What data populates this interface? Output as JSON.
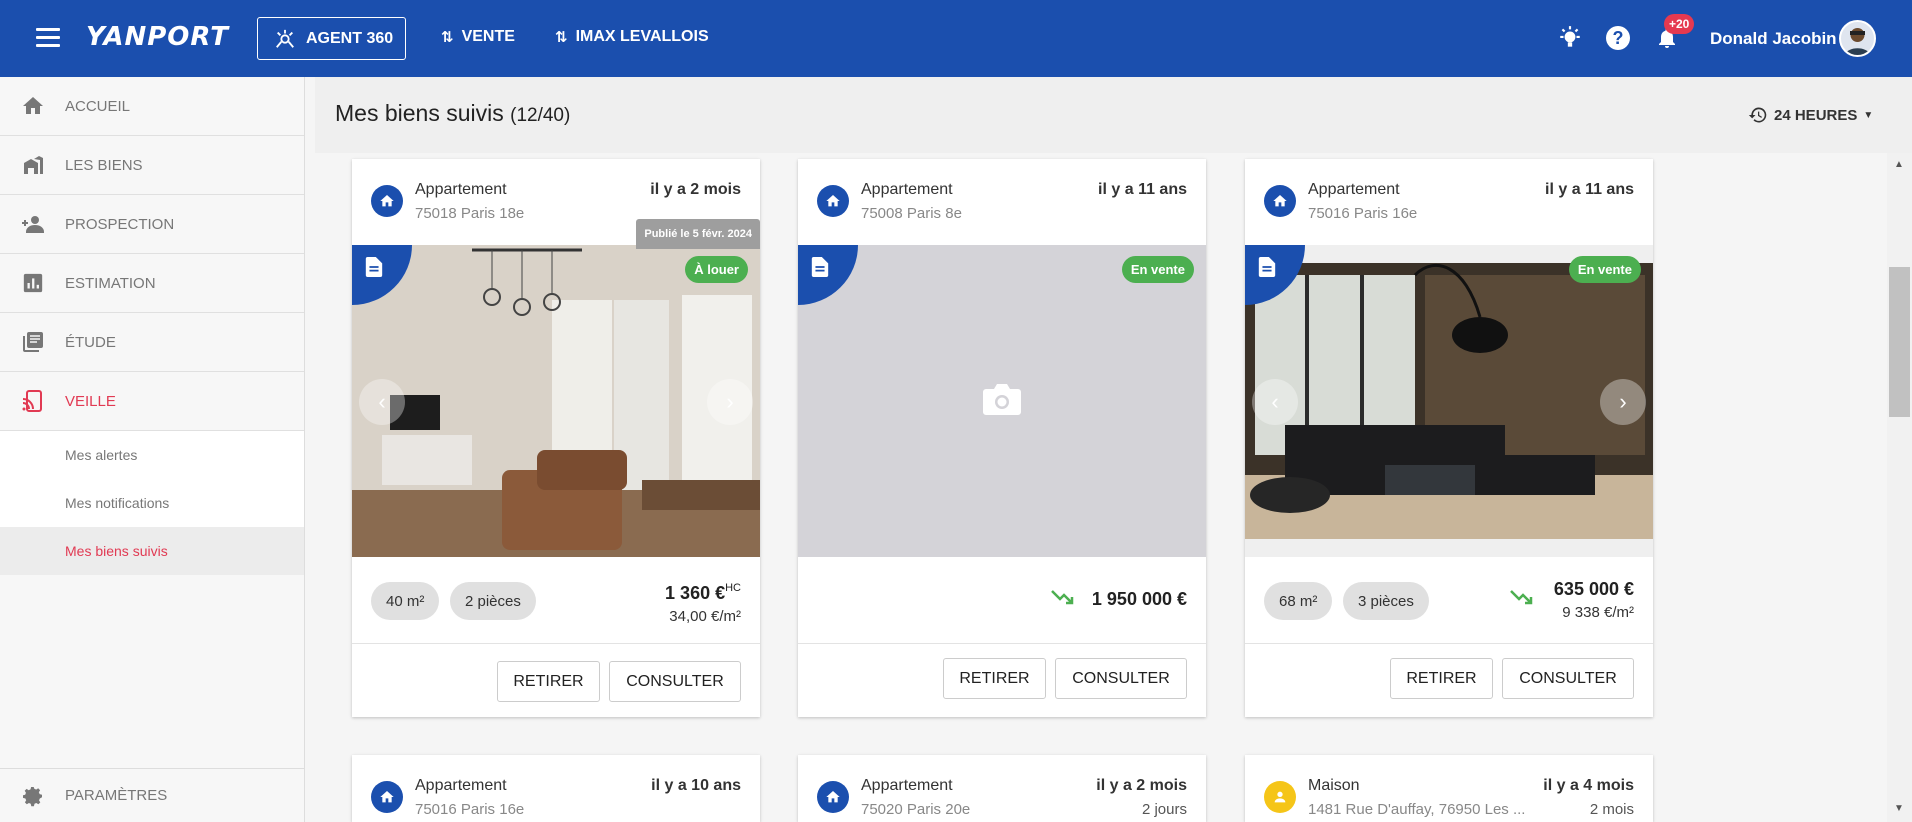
{
  "header": {
    "logo": "YANPORT",
    "agent_button": "AGENT 360",
    "nav": [
      "VENTE",
      "IMAX LEVALLOIS"
    ],
    "notifications_badge": "+20",
    "username": "Donald Jacobin"
  },
  "sidebar": {
    "items": [
      {
        "label": "ACCUEIL",
        "icon": "home-icon"
      },
      {
        "label": "LES BIENS",
        "icon": "buildings-icon"
      },
      {
        "label": "PROSPECTION",
        "icon": "person-add-icon"
      },
      {
        "label": "ESTIMATION",
        "icon": "bar-chart-icon"
      },
      {
        "label": "ÉTUDE",
        "icon": "library-icon"
      },
      {
        "label": "VEILLE",
        "icon": "cast-icon"
      }
    ],
    "subitems": [
      "Mes alertes",
      "Mes notifications",
      "Mes biens suivis"
    ],
    "settings_label": "PARAMÈTRES",
    "accent_color": "#e13a53"
  },
  "page": {
    "title": "Mes biens suivis",
    "count": "(12/40)",
    "period": "24 HEURES"
  },
  "cards": [
    {
      "type": "Appartement",
      "address": "75018 Paris 18e",
      "time": "il y a 2 mois",
      "published": "Publié le 5 févr. 2024",
      "status": "À louer",
      "surface": "40 m²",
      "rooms": "2 pièces",
      "price": "1 360 €",
      "price_suffix": "HC",
      "price_per_m2": "34,00 €/m²",
      "btn_remove": "RETIRER",
      "btn_view": "CONSULTER"
    },
    {
      "type": "Appartement",
      "address": "75008 Paris 8e",
      "time": "il y a 11 ans",
      "status": "En vente",
      "price": "1 950 000 €",
      "btn_remove": "RETIRER",
      "btn_view": "CONSULTER"
    },
    {
      "type": "Appartement",
      "address": "75016 Paris 16e",
      "time": "il y a 11 ans",
      "status": "En vente",
      "surface": "68 m²",
      "rooms": "3 pièces",
      "price": "635 000 €",
      "price_per_m2": "9 338 €/m²",
      "btn_remove": "RETIRER",
      "btn_view": "CONSULTER"
    },
    {
      "type": "Appartement",
      "address": "75016 Paris 16e",
      "time": "il y a 10 ans"
    },
    {
      "type": "Appartement",
      "address": "75020 Paris 20e",
      "time": "il y a 2 mois",
      "sub": "2 jours"
    },
    {
      "type": "Maison",
      "address": "1481 Rue D'auffay, 76950 Les ...",
      "time": "il y a 4 mois",
      "sub": "2 mois"
    }
  ],
  "colors": {
    "primary": "#1b4fae",
    "status_green": "#4caf50",
    "notification": "#e53950"
  }
}
